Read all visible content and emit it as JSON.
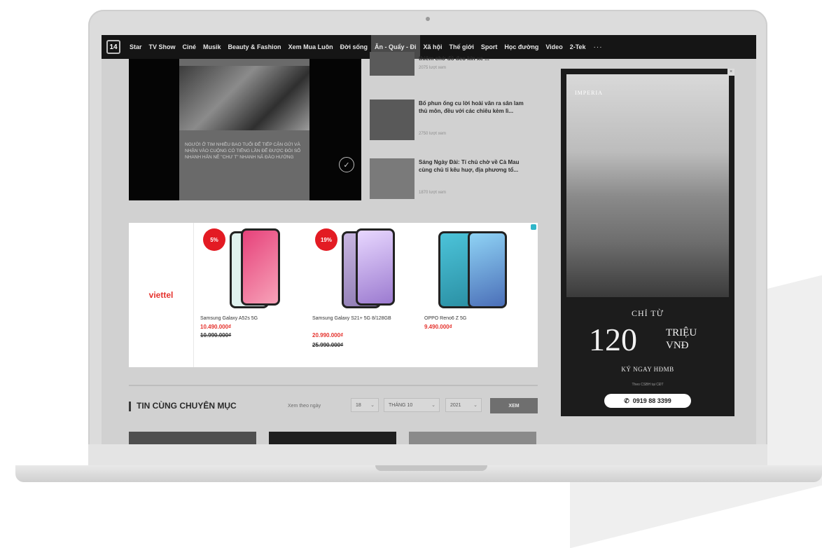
{
  "nav": {
    "logo": "14",
    "items": [
      "Star",
      "TV Show",
      "Ciné",
      "Musik",
      "Beauty & Fashion",
      "Xem Mua Luôn",
      "Đời sống",
      "Ăn - Quẩy - Đi",
      "Xã hội",
      "Thế giới",
      "Sport",
      "Học đường",
      "Video",
      "2-Tek"
    ],
    "active_index": 7,
    "more": "···"
  },
  "video": {
    "caption": "NGƯỜI Ở TIM NHIỀU BAO TUỔI ĐỂ TIẾP CẬN GỬI VÀ NHẬN VÀO CUỘNG CÓ TIẾNG LẦN ĐỂ ĐƯỢC ĐÓI SỐ NHANH HẢN NÊ \"CHƯ T\" NHANH NĂ ĐÀO HƯỚNG"
  },
  "news": [
    {
      "title": "thiêm chờ đồ đeo kín xe ...",
      "meta": "2075 lượt xem"
    },
    {
      "title": "Bố phun ống cu lời hoài văn ra sân lam thủ môn, đều với các chiêu kèm lì...",
      "meta": "2750 lượt xem"
    },
    {
      "title": "Sáng Ngày Đài: Tí chủ chờ về Cà Mau cùng chủ tỉ kêu huợ, địa phương tổ...",
      "meta": "1870 lượt xem"
    }
  ],
  "ad": {
    "brand": "viettel",
    "products": [
      {
        "discount": "5%",
        "name": "Samsung Galaxy A52s 5G",
        "price_new": "10.490.000₫",
        "price_old": "10.990.000₫"
      },
      {
        "discount": "19%",
        "name": "Samsung Galaxy S21+ 5G 8/128GB",
        "price_new": "20.990.000₫",
        "price_old": "25.990.000₫"
      },
      {
        "discount": "",
        "name": "OPPO Reno6 Z 5G",
        "price_new": "9.490.000₫",
        "price_old": ""
      }
    ]
  },
  "section": {
    "title": "TIN CÙNG CHUYÊN MỤC",
    "filter_label": "Xem theo ngày",
    "day": "18",
    "month": "THÁNG 10",
    "year": "2021",
    "view_button": "XEM"
  },
  "side_ad": {
    "logo": "IMPERIA",
    "chi_tu": "CHỈ TỪ",
    "amount": "120",
    "unit_line1": "TRIỆU",
    "unit_line2": "VNĐ",
    "sub": "KÝ NGAY HĐMB",
    "tiny": "Theo CSBH tại CĐT",
    "phone": "0919 88 3399"
  },
  "colors": {
    "accent_red": "#e5322d",
    "nav_bg": "#151515"
  }
}
